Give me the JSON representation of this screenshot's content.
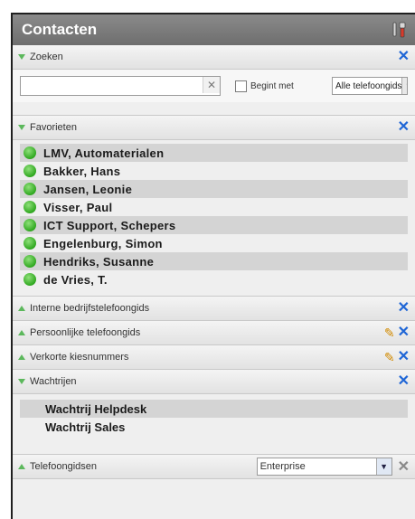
{
  "window": {
    "title": "Contacten",
    "tools_icon": "tools-icon"
  },
  "sections": {
    "search": {
      "label": "Zoeken",
      "input_value": "",
      "input_placeholder": "",
      "checkbox_label": "Begint met",
      "checkbox_checked": false,
      "select_value": "Alle telefoongids"
    },
    "favorites": {
      "label": "Favorieten",
      "items": [
        "LMV, Automaterialen",
        "Bakker, Hans",
        "Jansen, Leonie",
        "Visser, Paul",
        "ICT Support, Schepers",
        "Engelenburg, Simon",
        "Hendriks, Susanne",
        "de Vries, T."
      ],
      "status_color": "#2fa81f"
    },
    "internal_directory": {
      "label": "Interne bedrijfstelefoongids"
    },
    "personal_directory": {
      "label": "Persoonlijke telefoongids"
    },
    "speed_dials": {
      "label": "Verkorte kiesnummers"
    },
    "queues": {
      "label": "Wachtrijen",
      "items": [
        "Wachtrij Helpdesk",
        "Wachtrij Sales"
      ]
    },
    "phonebooks": {
      "label": "Telefoongidsen",
      "select_value": "Enterprise"
    }
  },
  "colors": {
    "accent": "#1f66d6",
    "status_green": "#2fa81f",
    "titlebar": "#7a7a7a"
  }
}
